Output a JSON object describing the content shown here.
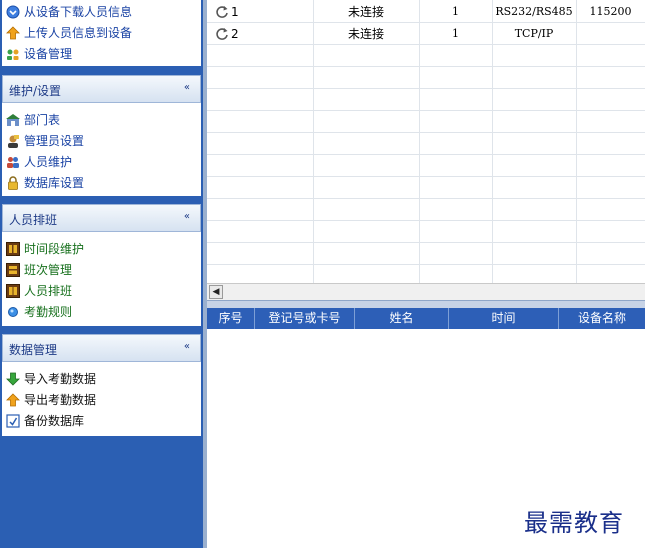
{
  "sidebar": {
    "top_items": [
      {
        "label": "从设备下载人员信息",
        "icon": "download-circle-icon"
      },
      {
        "label": "上传人员信息到设备",
        "icon": "upload-arrow-icon"
      },
      {
        "label": "设备管理",
        "icon": "device-users-icon"
      }
    ],
    "panels": [
      {
        "title": "维护/设置",
        "toggle": "«",
        "items": [
          {
            "label": "部门表",
            "icon": "department-icon"
          },
          {
            "label": "管理员设置",
            "icon": "admin-icon"
          },
          {
            "label": "人员维护",
            "icon": "people-icon"
          },
          {
            "label": "数据库设置",
            "icon": "lock-icon"
          }
        ]
      },
      {
        "title": "人员排班",
        "toggle": "«",
        "items": [
          {
            "label": "时间段维护",
            "icon": "time-period-icon"
          },
          {
            "label": "班次管理",
            "icon": "shift-icon"
          },
          {
            "label": "人员排班",
            "icon": "schedule-icon"
          },
          {
            "label": "考勤规则",
            "icon": "rule-dot-icon"
          }
        ]
      },
      {
        "title": "数据管理",
        "toggle": "«",
        "items": [
          {
            "label": "导入考勤数据",
            "icon": "import-arrow-icon"
          },
          {
            "label": "导出考勤数据",
            "icon": "export-arrow-icon"
          },
          {
            "label": "备份数据库",
            "icon": "backup-icon"
          }
        ]
      }
    ]
  },
  "device_grid": {
    "rows": [
      {
        "id": "1",
        "status": "未连接",
        "number": "1",
        "comm": "RS232/RS485",
        "baud": "115200"
      },
      {
        "id": "2",
        "status": "未连接",
        "number": "1",
        "comm": "TCP/IP",
        "baud": ""
      }
    ]
  },
  "scrollbar": {
    "left_arrow": "◀"
  },
  "records": {
    "columns": [
      "序号",
      "登记号或卡号",
      "姓名",
      "时间",
      "设备名称"
    ]
  },
  "watermark": "最需教育",
  "colors": {
    "sidebar_bg": "#2b5fb3",
    "header_bg": "#2d5fb7",
    "status_text": "#1a1a1a",
    "watermark": "#1a2f8a"
  }
}
